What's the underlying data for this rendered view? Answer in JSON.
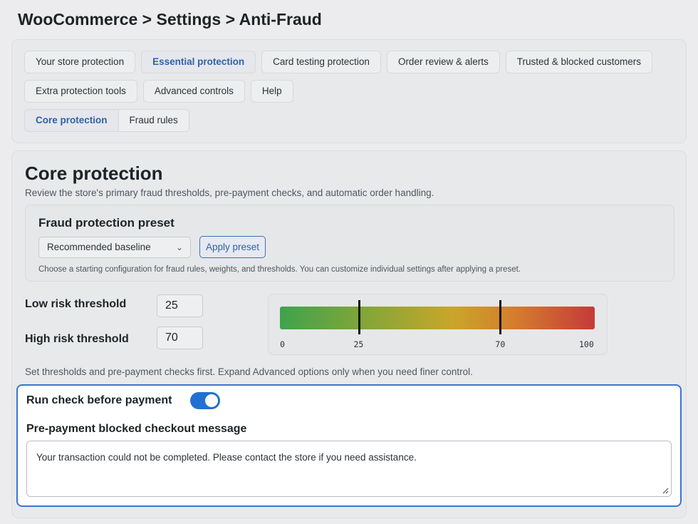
{
  "page": {
    "title": "WooCommerce > Settings > Anti-Fraud"
  },
  "tabs": {
    "row1": [
      "Your store protection",
      "Essential protection",
      "Card testing protection",
      "Order review & alerts",
      "Trusted & blocked customers"
    ],
    "row2": [
      "Extra protection tools",
      "Advanced controls",
      "Help"
    ],
    "subtabs": [
      "Core protection",
      "Fraud rules"
    ],
    "active_main": "Essential protection",
    "active_sub": "Core protection"
  },
  "section": {
    "title": "Core protection",
    "description": "Review the store's primary fraud thresholds, pre-payment checks, and automatic order handling."
  },
  "preset": {
    "title": "Fraud protection preset",
    "selected": "Recommended baseline",
    "apply_label": "Apply preset",
    "help": "Choose a starting configuration for fraud rules, weights, and thresholds. You can customize individual settings after applying a preset."
  },
  "thresholds": {
    "low_label": "Low risk threshold",
    "low_value": "25",
    "high_label": "High risk threshold",
    "high_value": "70",
    "scale_ticks": [
      "0",
      "25",
      "70",
      "100"
    ],
    "scale_min": 0,
    "scale_max": 100,
    "hint": "Set thresholds and pre-payment checks first. Expand Advanced options only when you need finer control."
  },
  "prepayment": {
    "run_label": "Run check before payment",
    "run_enabled": true,
    "message_label": "Pre-payment blocked checkout message",
    "message_value": "Your transaction could not be completed. Please contact the store if you need assistance."
  },
  "colors": {
    "accent": "#2271d1",
    "active_tab_text": "#2f62a8",
    "gradient_low": "#3fa34d",
    "gradient_high": "#c43a3a"
  }
}
